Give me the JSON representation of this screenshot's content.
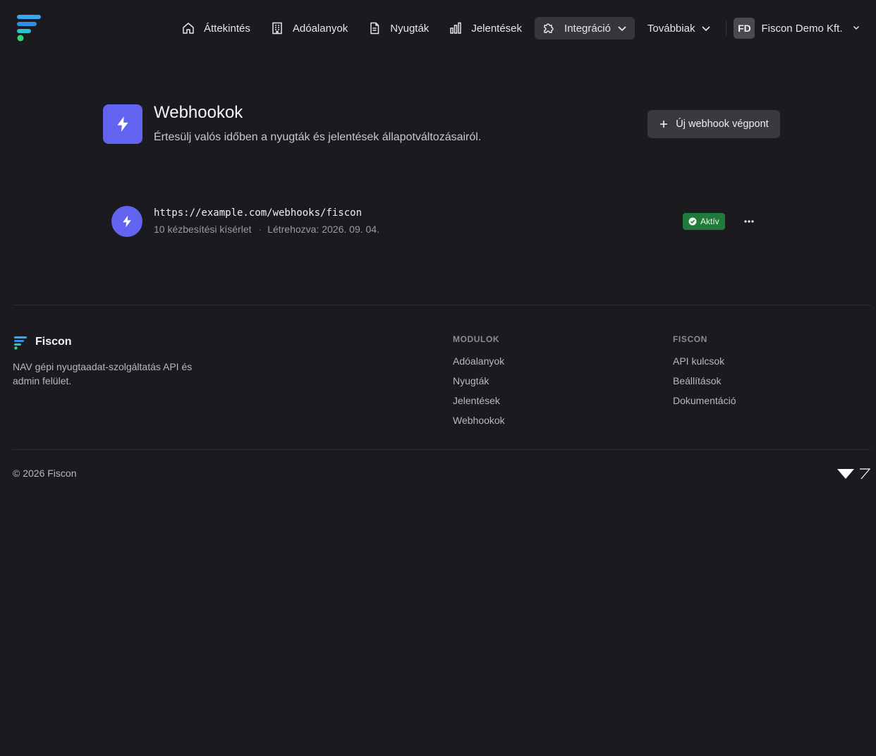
{
  "header": {
    "nav": [
      {
        "label": "Áttekintés",
        "icon": "home-icon"
      },
      {
        "label": "Adóalanyok",
        "icon": "building-icon"
      },
      {
        "label": "Nyugták",
        "icon": "document-icon"
      },
      {
        "label": "Jelentések",
        "icon": "bar-chart-icon"
      },
      {
        "label": "Integráció",
        "icon": "puzzle-icon",
        "active": true,
        "has_dropdown": true
      },
      {
        "label": "Továbbiak",
        "has_dropdown": true
      }
    ],
    "account": {
      "initials": "FD",
      "name": "Fiscon Demo Kft."
    }
  },
  "page": {
    "title": "Webhookok",
    "subtitle": "Értesülj valós időben a nyugták és jelentések állapotváltozásairól.",
    "new_button": "Új webhook végpont"
  },
  "webhooks": [
    {
      "url": "https://example.com/webhooks/fiscon",
      "attempts": "10 kézbesítési kísérlet",
      "separator": "·",
      "created": "Létrehozva: 2026. 09. 04.",
      "status": "Aktív"
    }
  ],
  "footer": {
    "brand": "Fiscon",
    "description": "NAV gépi nyugtaadat-szolgáltatás API és admin felület.",
    "columns": [
      {
        "title": "MODULOK",
        "links": [
          "Adóalanyok",
          "Nyugták",
          "Jelentések",
          "Webhookok"
        ]
      },
      {
        "title": "FISCON",
        "links": [
          "API kulcsok",
          "Beállítások",
          "Dokumentáció"
        ]
      }
    ],
    "copyright": "© 2026 Fiscon"
  },
  "colors": {
    "background": "#1b1a1e",
    "accent": "#6263f0",
    "status_active": "#1f7a3b",
    "logo_blue": "#3aa0f0",
    "logo_green": "#2ed47a"
  }
}
